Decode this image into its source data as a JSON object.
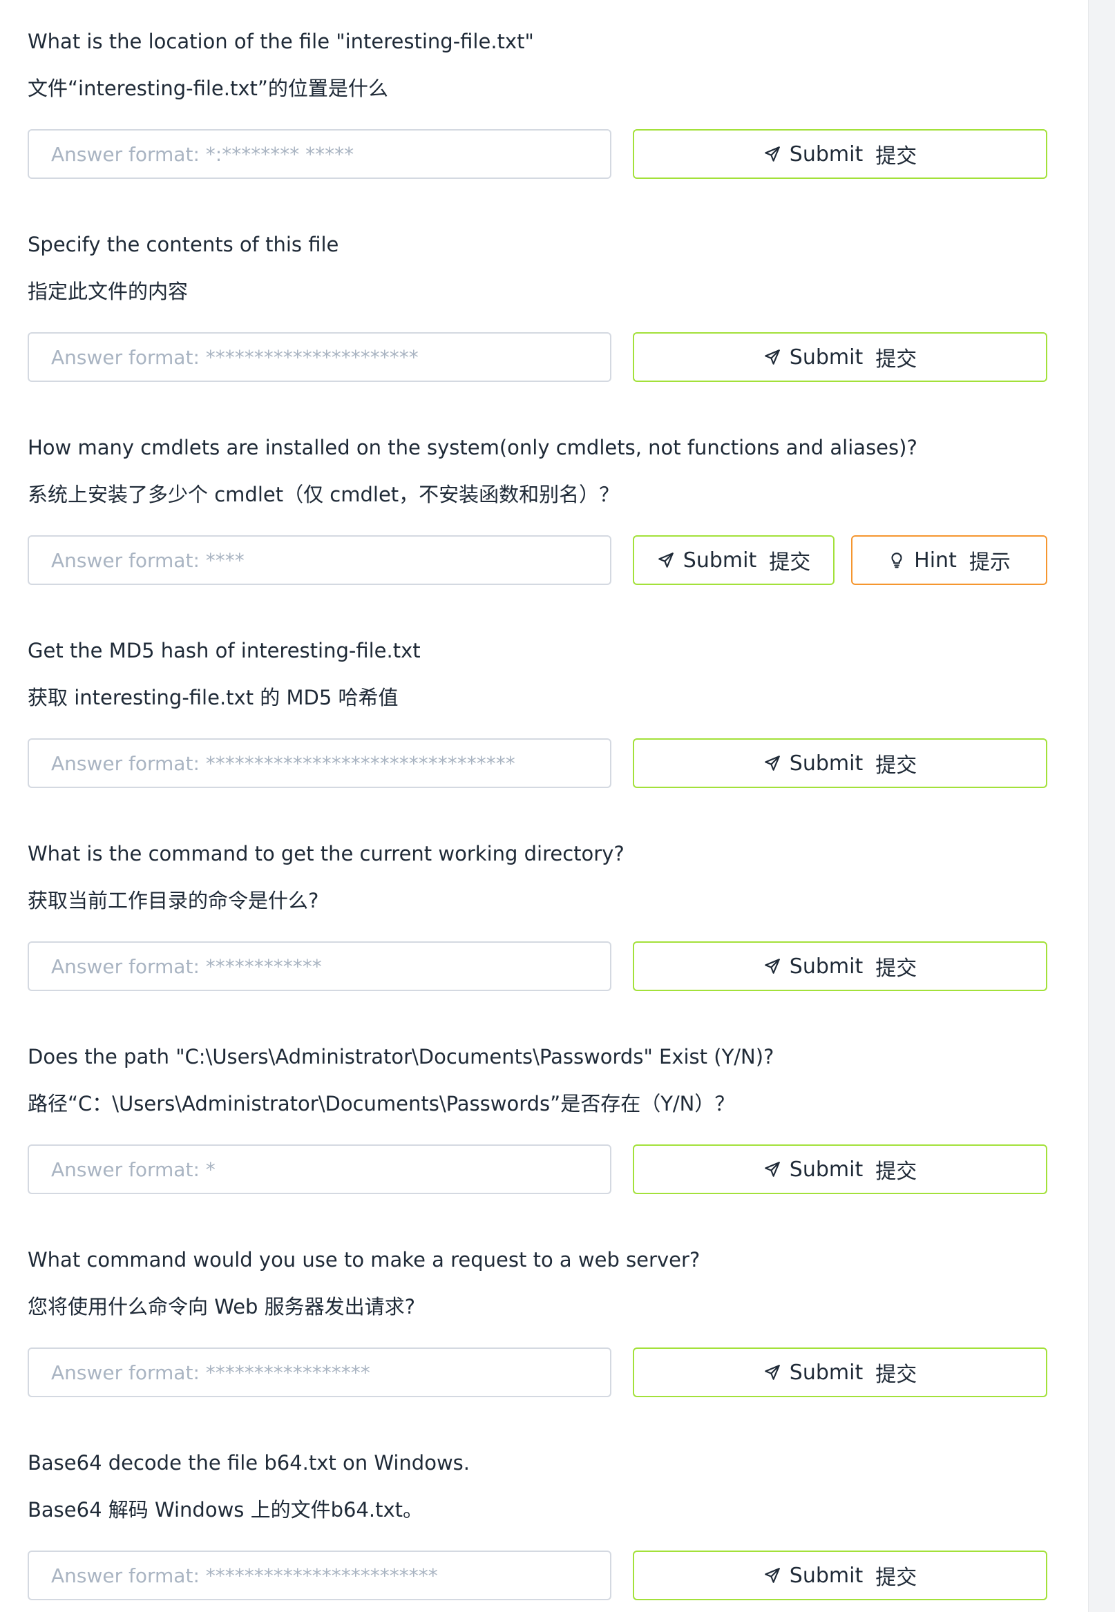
{
  "questions": [
    {
      "text_en": "What is the location of the file \"interesting-file.txt\"",
      "text_zh": "文件“interesting-file.txt”的位置是什么",
      "placeholder": "Answer format: *:******** *****",
      "submit_label": "Submit",
      "submit_label_zh": "提交"
    },
    {
      "text_en": "Specify the contents of this file",
      "text_zh": "指定此文件的内容",
      "placeholder": "Answer format: **********************",
      "submit_label": "Submit",
      "submit_label_zh": "提交"
    },
    {
      "text_en": "How many cmdlets are installed on the system(only cmdlets, not functions and aliases)?",
      "text_zh": "系统上安装了多少个 cmdlet（仅 cmdlet，不安装函数和别名）？",
      "placeholder": "Answer format: ****",
      "submit_label": "Submit",
      "submit_label_zh": "提交",
      "hint_label": "Hint",
      "hint_label_zh": "提示"
    },
    {
      "text_en": "Get the MD5 hash of interesting-file.txt",
      "text_zh": "获取 interesting-file.txt 的 MD5 哈希值",
      "placeholder": "Answer format: ********************************",
      "submit_label": "Submit",
      "submit_label_zh": "提交"
    },
    {
      "text_en": "What is the command to get the current working directory?",
      "text_zh": "获取当前工作目录的命令是什么?",
      "placeholder": "Answer format: ************",
      "submit_label": "Submit",
      "submit_label_zh": "提交"
    },
    {
      "text_en": "Does the path \"C:\\Users\\Administrator\\Documents\\Passwords\" Exist (Y/N)?",
      "text_zh": "路径“C：\\Users\\Administrator\\Documents\\Passwords”是否存在（Y/N）？",
      "placeholder": "Answer format: *",
      "submit_label": "Submit",
      "submit_label_zh": "提交"
    },
    {
      "text_en": "What command would you use to make a request to a web server?",
      "text_zh": "您将使用什么命令向 Web 服务器发出请求?",
      "placeholder": "Answer format: *****************",
      "submit_label": "Submit",
      "submit_label_zh": "提交"
    },
    {
      "text_en": "Base64 decode the file b64.txt on Windows.",
      "text_zh": "Base64 解码 Windows 上的文件b64.txt。",
      "placeholder": "Answer format: ************************",
      "submit_label": "Submit",
      "submit_label_zh": "提交"
    }
  ],
  "icons": {
    "submit": "paper-plane-icon",
    "hint": "lightbulb-icon"
  },
  "colors": {
    "submit_border": "#a3e13a",
    "hint_border": "#f5962f",
    "input_border": "#d4d9e1",
    "placeholder": "#a9b4c2",
    "text": "#1f2a37"
  }
}
